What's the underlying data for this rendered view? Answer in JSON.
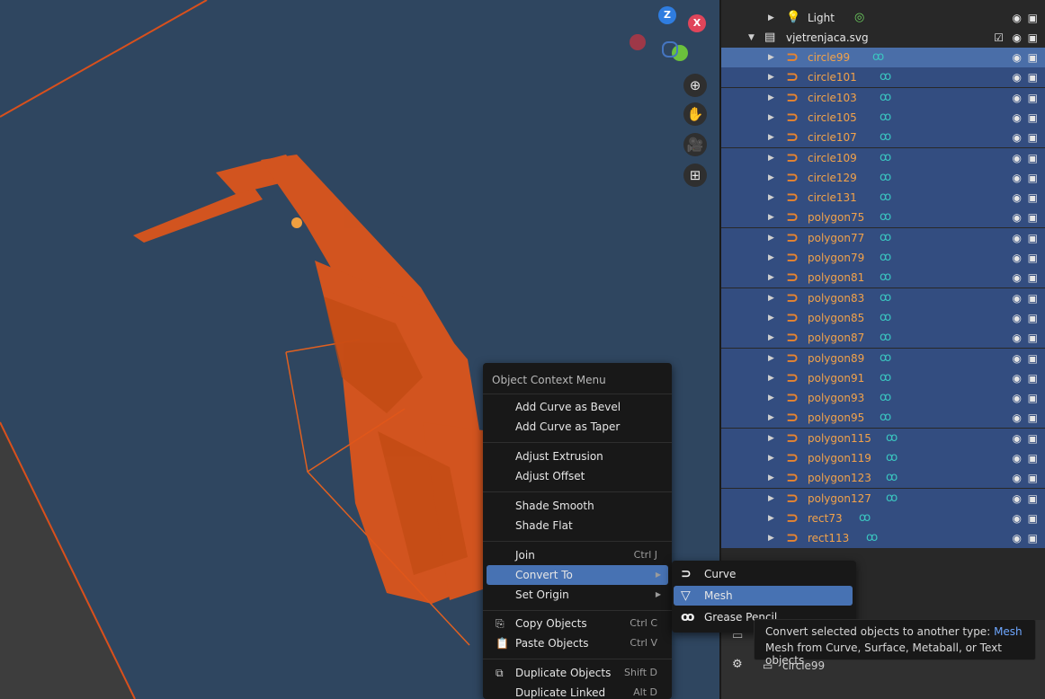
{
  "viewport": {
    "gizmo": {
      "z": "Z",
      "x": "X"
    },
    "nav_icons": [
      "zoom-icon",
      "hand-icon",
      "camera-icon",
      "grid-icon"
    ]
  },
  "outliner": {
    "light_row": "Light",
    "collection": "vjetrenjaca.svg",
    "items": [
      "circle99",
      "circle101",
      "circle103",
      "circle105",
      "circle107",
      "circle109",
      "circle129",
      "circle131",
      "polygon75",
      "polygon77",
      "polygon79",
      "polygon81",
      "polygon83",
      "polygon85",
      "polygon87",
      "polygon89",
      "polygon91",
      "polygon93",
      "polygon95",
      "polygon115",
      "polygon119",
      "polygon123",
      "polygon127",
      "rect73",
      "rect113"
    ]
  },
  "properties": {
    "object_name": "circle99"
  },
  "context_menu": {
    "title": "Object Context Menu",
    "items": {
      "bevel": "Add Curve as Bevel",
      "taper": "Add Curve as Taper",
      "extrusion": "Adjust Extrusion",
      "offset": "Adjust Offset",
      "smooth": "Shade Smooth",
      "flat": "Shade Flat",
      "join": "Join",
      "join_sc": "Ctrl J",
      "convert": "Convert To",
      "origin": "Set Origin",
      "copy": "Copy Objects",
      "copy_sc": "Ctrl C",
      "paste": "Paste Objects",
      "paste_sc": "Ctrl V",
      "duplicate": "Duplicate Objects",
      "duplicate_sc": "Shift D",
      "linked": "Duplicate Linked",
      "linked_sc": "Alt D"
    }
  },
  "submenu": {
    "curve": "Curve",
    "mesh": "Mesh",
    "grease": "Grease Pencil"
  },
  "tooltip": {
    "line1_prefix": "Convert selected objects to another type:",
    "line1_value": "Mesh",
    "line2": "Mesh from Curve, Surface, Metaball, or Text objects"
  },
  "colors": {
    "accent": "#4772b3",
    "curve_orange": "#e8842f",
    "modifier_teal": "#3bc6c0",
    "plane_blue": "#2f4660"
  }
}
